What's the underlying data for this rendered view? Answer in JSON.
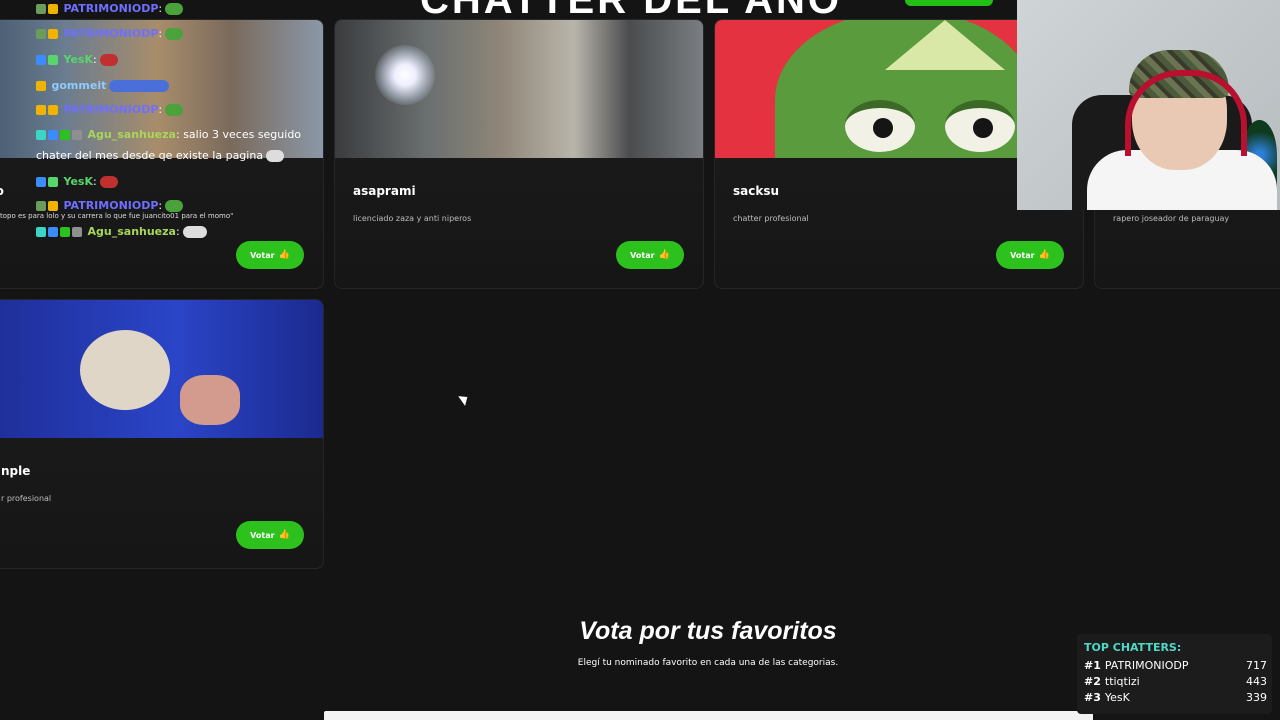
{
  "banner": {
    "title": "CHATTER DEL AÑO"
  },
  "cards": [
    {
      "name": "topo",
      "desc": "",
      "vote": "Votar"
    },
    {
      "name": "asaprami",
      "desc": "licenciado zaza y anti niperos",
      "vote": "Votar"
    },
    {
      "name": "sacksu",
      "desc": "chatter profesional",
      "vote": "Votar"
    },
    {
      "name": "",
      "desc": "rapero joseador de paraguay",
      "vote": "Votar"
    },
    {
      "name": "nple",
      "desc": "r profesional",
      "vote": "Votar"
    }
  ],
  "chat": {
    "messages": [
      {
        "user": "PATRIMONIODP",
        "sep": ":",
        "text": ""
      },
      {
        "user": "PATRIMONIODP",
        "sep": ":",
        "text": ""
      },
      {
        "user": "YesK",
        "sep": ":",
        "text": ""
      },
      {
        "user": "gommeit",
        "sep": "",
        "text": ""
      },
      {
        "user": "PATRIMONIODP",
        "sep": ":",
        "text": ""
      },
      {
        "user": "Agu_sanhueza",
        "sep": ":",
        "text": "salio 3 veces seguido"
      },
      {
        "user": "",
        "sep": "",
        "text": "chater del mes desde qe existe la pagina"
      },
      {
        "user": "YesK",
        "sep": ":",
        "text": ""
      },
      {
        "user": "PATRIMONIODP",
        "sep": ":",
        "text": ""
      },
      {
        "user": "Agu_sanhueza",
        "sep": ":",
        "text": ""
      }
    ],
    "small_line": "topo es para lolo y su carrera lo que fue juancito01 para el momo\""
  },
  "section": {
    "title": "Vota por tus favoritos",
    "subtitle": "Elegí tu nominado favorito en cada una de las categorias."
  },
  "top_chatters": {
    "title": "TOP CHATTERS:",
    "rows": [
      {
        "rank": "#1",
        "name": "PATRIMONIODP",
        "count": "717"
      },
      {
        "rank": "#2",
        "name": "ttiqtizi",
        "count": "443"
      },
      {
        "rank": "#3",
        "name": "YesK",
        "count": "339"
      }
    ]
  },
  "icons": {
    "vote": "thumbs-up-icon",
    "cursor": "mouse-pointer-icon"
  },
  "colors": {
    "accent_green": "#2cc11d",
    "background": "#141414",
    "top_chatters_title": "#4fd8c6"
  }
}
